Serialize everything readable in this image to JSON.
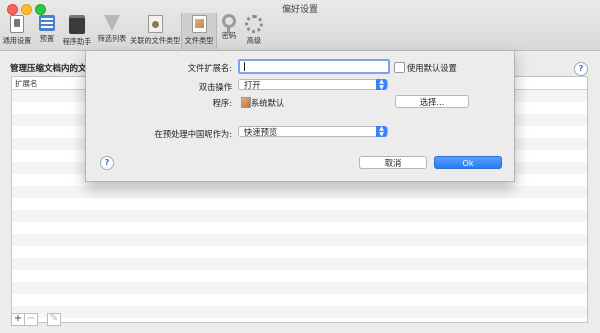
{
  "window": {
    "title": "偏好设置"
  },
  "toolbar": {
    "items": [
      {
        "label": "通用设置",
        "icon": "general-icon"
      },
      {
        "label": "预置",
        "icon": "preset-icon"
      },
      {
        "label": "程序助手",
        "icon": "script-icon"
      },
      {
        "label": "筛选列表",
        "icon": "filter-icon"
      },
      {
        "label": "关联的文件类型",
        "icon": "association-icon"
      },
      {
        "label": "文件类型",
        "icon": "file-type-icon",
        "selected": true
      },
      {
        "label": "密码",
        "icon": "key-icon"
      },
      {
        "label": "高级",
        "icon": "gear-icon"
      }
    ]
  },
  "main": {
    "section_title": "管理压缩文档内的文",
    "table": {
      "columns": [
        "扩展名"
      ],
      "rows": []
    },
    "bottom": {
      "add": "+",
      "remove": "−"
    }
  },
  "sheet": {
    "ext_label": "文件扩展名:",
    "ext_value": "",
    "default_label": "使用默认设置",
    "dblclick_label": "双击操作",
    "dblclick_value": "打开",
    "program_label": "程序:",
    "program_value": "系统默认",
    "choose_button": "选择...",
    "preview_label": "在预处理中国呢作为:",
    "preview_value": "快速预览",
    "cancel_button": "取消",
    "ok_button": "Ok",
    "help": "?"
  },
  "colors": {
    "accent": "#2a7cf5"
  }
}
